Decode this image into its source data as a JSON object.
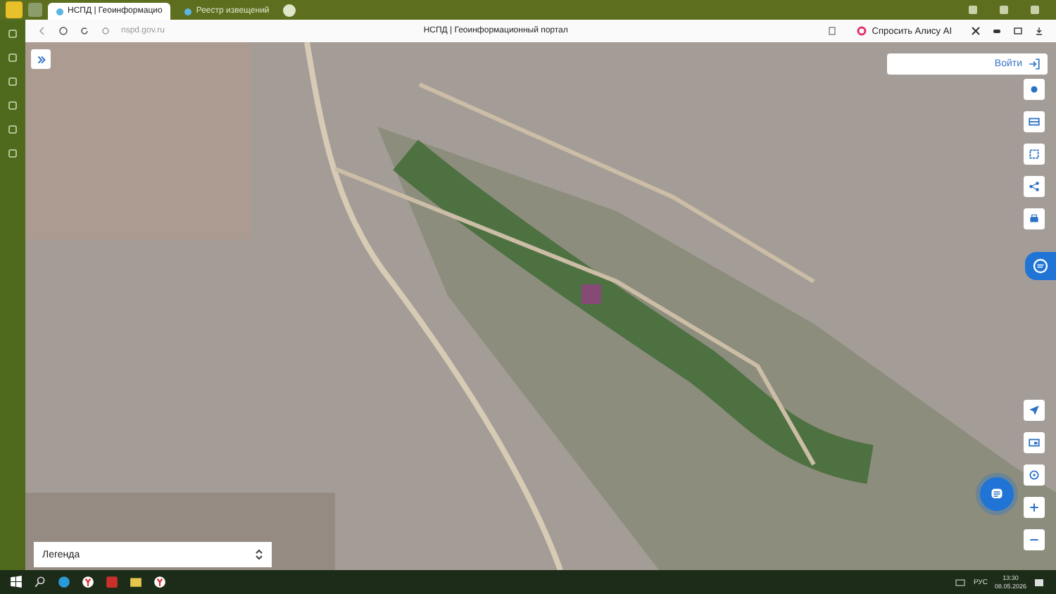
{
  "browser": {
    "tabs": [
      {
        "title": "НСПД | Геоинформацио",
        "selected": true
      },
      {
        "title": "Реестр извещений",
        "selected": false
      }
    ],
    "address": "nspd.gov.ru",
    "page_title": "НСПД | Геоинформационный портал",
    "assistant_button": "Спросить Алису AI"
  },
  "map": {
    "login_button": "Войти",
    "legend": {
      "label": "Легенда"
    }
  },
  "taskbar": {
    "language": "РУС",
    "time": "13:30",
    "date": "08.05.2026"
  }
}
